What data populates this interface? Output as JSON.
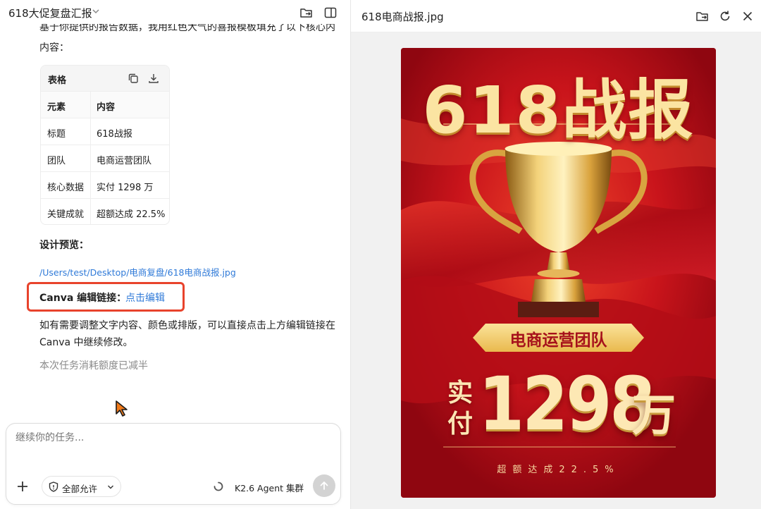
{
  "left_panel": {
    "conversation_title": "618大促复盘汇报",
    "intro_text": "基于你提供的报告数据，我用红色大气的喜报模板填充了以下核心内容：",
    "table": {
      "label": "表格",
      "columns": [
        "元素",
        "内容"
      ],
      "rows": [
        [
          "标题",
          "618战报"
        ],
        [
          "团队",
          "电商运营团队"
        ],
        [
          "核心数据",
          "实付 1298 万"
        ],
        [
          "关键成就",
          "超额达成 22.5%"
        ]
      ]
    },
    "design_preview_label": "设计预览：",
    "file_path": "/Users/test/Desktop/电商复盘/618电商战报.jpg",
    "canva_label": "Canva 编辑链接：",
    "canva_link": "点击编辑",
    "hint_text": "如有需要调整文字内容、颜色或排版，可以直接点击上方编辑链接在 Canva 中继续修改。",
    "quota_text": "本次任务消耗额度已减半",
    "composer": {
      "placeholder": "继续你的任务...",
      "permission_label": "全部允许",
      "agent_label": "K2.6 Agent 集群"
    }
  },
  "right_panel": {
    "file_title": "618电商战报.jpg",
    "poster": {
      "title": "618战报",
      "team": "电商运营团队",
      "paid_label": "实付",
      "amount": "1298",
      "unit": "万",
      "achievement": "超额达成22.5%"
    }
  },
  "colors": {
    "accent_red": "#e8432c",
    "link_blue": "#2f7ad8",
    "poster_red": "#c8141a",
    "poster_gold": "#fbe4a2"
  },
  "icons": [
    "chevron-down-icon",
    "folder-export-icon",
    "sidebar-toggle-icon",
    "copy-icon",
    "download-icon",
    "cursor-icon",
    "plus-icon",
    "shield-icon",
    "spinner-icon",
    "send-arrow-icon",
    "refresh-icon",
    "close-icon",
    "trophy-icon"
  ]
}
